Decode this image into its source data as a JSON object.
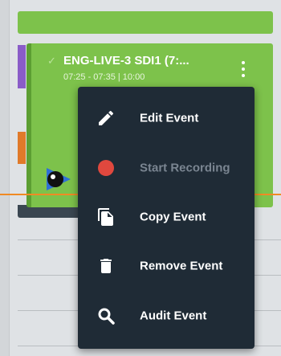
{
  "event": {
    "title": "ENG-LIVE-3 SDI1 (7:...",
    "time_range": "07:25 - 07:35 | 10:00",
    "status_icon": "check-icon",
    "color": "#7dc24b"
  },
  "colors": {
    "menu_bg": "#1f2b36",
    "now_line": "#f08a24",
    "record_dot": "#e0483e",
    "side_purple": "#8a5cc8",
    "side_orange": "#e07a2a"
  },
  "context_menu": {
    "items": [
      {
        "label": "Edit Event",
        "icon": "pencil-icon",
        "enabled": true
      },
      {
        "label": "Start Recording",
        "icon": "record-icon",
        "enabled": false
      },
      {
        "label": "Copy Event",
        "icon": "copy-icon",
        "enabled": true
      },
      {
        "label": "Remove Event",
        "icon": "trash-icon",
        "enabled": true
      },
      {
        "label": "Audit Event",
        "icon": "magnifier-icon",
        "enabled": true
      }
    ]
  }
}
